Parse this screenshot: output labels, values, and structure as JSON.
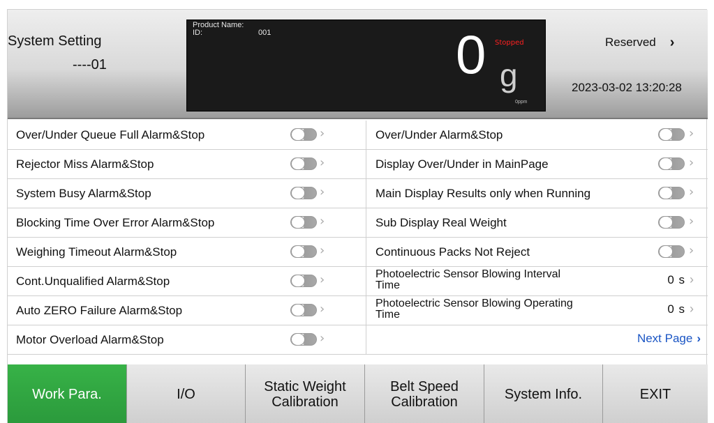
{
  "header": {
    "title": "System Setting",
    "subtitle": "----01",
    "reserved_label": "Reserved",
    "reserved_chevron": "›",
    "datetime": "2023-03-02 13:20:28"
  },
  "display": {
    "product_name_label": "Product Name:",
    "id_label": "ID:",
    "id_value": "001",
    "status": "Stopped",
    "weight": "0",
    "unit": "g",
    "rate": "0ppm",
    "status_color": "#ff2020"
  },
  "settings": {
    "left": [
      {
        "label": "Over/Under Queue Full Alarm&Stop",
        "type": "toggle",
        "on": false
      },
      {
        "label": "Rejector Miss Alarm&Stop",
        "type": "toggle",
        "on": false
      },
      {
        "label": "System Busy Alarm&Stop",
        "type": "toggle",
        "on": false
      },
      {
        "label": "Blocking Time Over Error Alarm&Stop",
        "type": "toggle",
        "on": false
      },
      {
        "label": "Weighing Timeout Alarm&Stop",
        "type": "toggle",
        "on": false
      },
      {
        "label": "Cont.Unqualified Alarm&Stop",
        "type": "toggle",
        "on": false
      },
      {
        "label": "Auto ZERO Failure Alarm&Stop",
        "type": "toggle",
        "on": false
      },
      {
        "label": "Motor Overload Alarm&Stop",
        "type": "toggle",
        "on": false
      }
    ],
    "right": [
      {
        "label": "Over/Under Alarm&Stop",
        "type": "toggle",
        "on": false
      },
      {
        "label": "Display Over/Under in MainPage",
        "type": "toggle",
        "on": false
      },
      {
        "label": "Main Display Results only when Running",
        "type": "toggle",
        "on": false
      },
      {
        "label": "Sub Display Real Weight",
        "type": "toggle",
        "on": false
      },
      {
        "label": "Continuous Packs Not Reject",
        "type": "toggle",
        "on": false
      },
      {
        "label": "Photoelectric Sensor Blowing Interval Time",
        "type": "value",
        "value": "0 s"
      },
      {
        "label": "Photoelectric Sensor Blowing Operating Time",
        "type": "value",
        "value": "0 s"
      }
    ],
    "next_page_label": "Next Page",
    "chevron": "›"
  },
  "nav": {
    "active_color": "#2ea640",
    "items": [
      {
        "label": "Work Para.",
        "active": true
      },
      {
        "label": "I/O",
        "active": false
      },
      {
        "label": "Static Weight Calibration",
        "active": false
      },
      {
        "label": "Belt Speed Calibration",
        "active": false
      },
      {
        "label": "System Info.",
        "active": false
      },
      {
        "label": "EXIT",
        "active": false
      }
    ]
  }
}
